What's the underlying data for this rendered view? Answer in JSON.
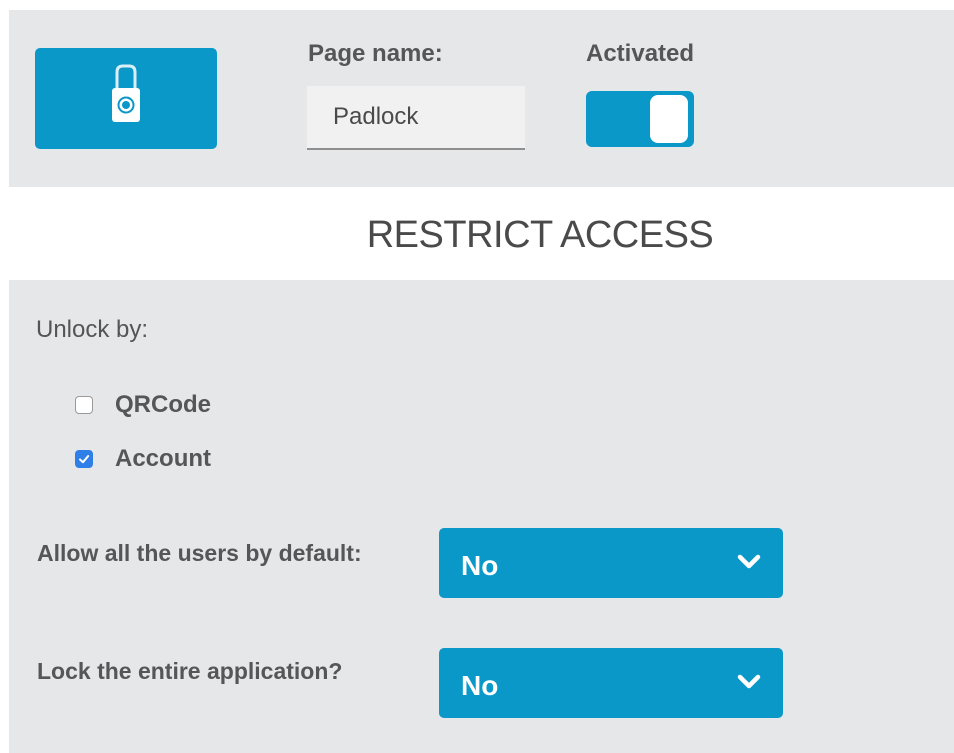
{
  "header": {
    "page_icon": "padlock-icon",
    "page_name_label": "Page name:",
    "page_name_value": "Padlock",
    "activated_label": "Activated",
    "activated": true
  },
  "section": {
    "title": "RESTRICT ACCESS"
  },
  "unlock": {
    "label": "Unlock by:",
    "options": [
      {
        "label": "QRCode",
        "checked": false
      },
      {
        "label": "Account",
        "checked": true
      }
    ]
  },
  "settings": {
    "allow_all_users": {
      "label": "Allow all the users by default:",
      "value": "No"
    },
    "lock_entire_app": {
      "label": "Lock the entire application?",
      "value": "No"
    }
  },
  "colors": {
    "accent": "#0a98c9",
    "panel_bg": "#e6e7e9",
    "checkbox_checked": "#2f7fe8",
    "text": "#565656"
  }
}
